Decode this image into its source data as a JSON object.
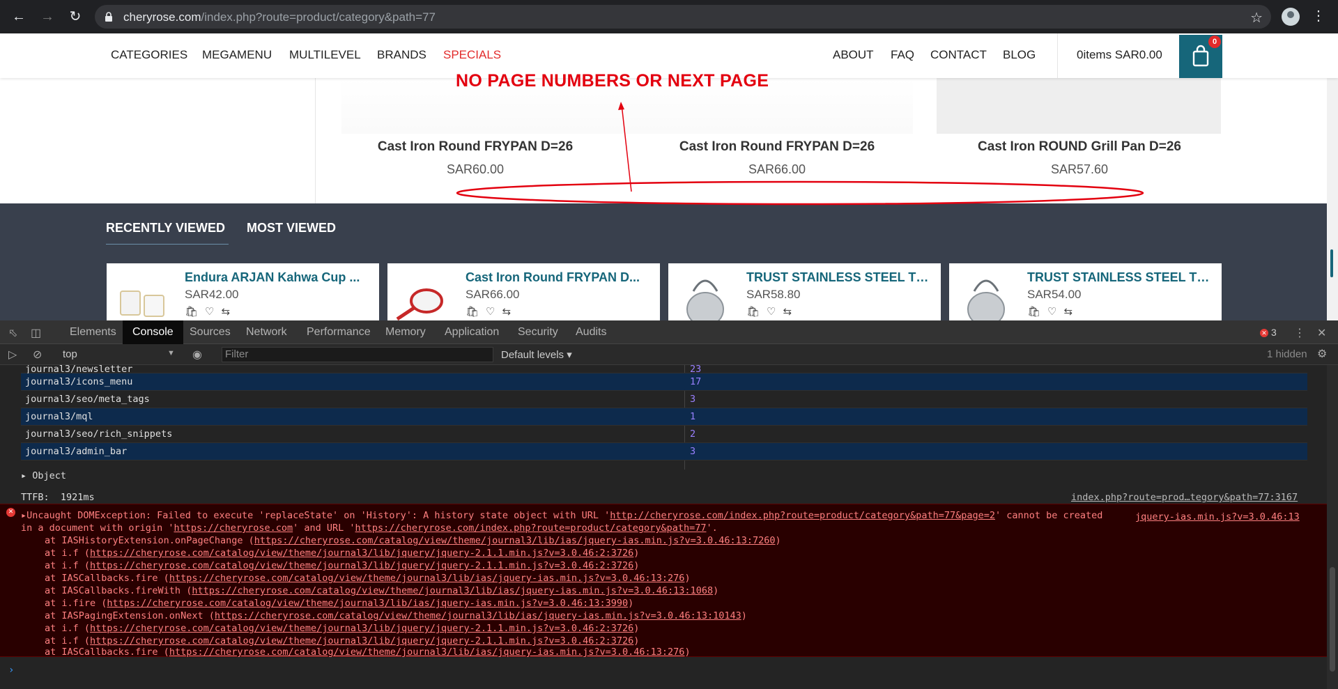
{
  "browser": {
    "url_host": "cheryrose.com",
    "url_path": "/index.php?route=product/category&path=77"
  },
  "header": {
    "menu_left": [
      "CATEGORIES",
      "MEGAMENU",
      "MULTILEVEL",
      "BRANDS",
      "SPECIALS"
    ],
    "menu_right": [
      "ABOUT",
      "FAQ",
      "CONTACT",
      "BLOG"
    ],
    "cart_text": "0items SAR0.00",
    "cart_badge": "0"
  },
  "annotation": {
    "text": "NO PAGE NUMBERS OR NEXT PAGE",
    "color": "#e3000f"
  },
  "products": [
    {
      "name": "Cast Iron Round FRYPAN D=26",
      "price": "SAR60.00"
    },
    {
      "name": "Cast Iron Round FRYPAN D=26",
      "price": "SAR66.00"
    },
    {
      "name": "Cast Iron ROUND Grill Pan D=26",
      "price": "SAR57.60"
    }
  ],
  "recent": {
    "tabs": [
      "RECENTLY VIEWED",
      "MOST VIEWED"
    ],
    "cards": [
      {
        "title": "Endura ARJAN Kahwa Cup ...",
        "price": "SAR42.00"
      },
      {
        "title": "Cast Iron Round FRYPAN D...",
        "price": "SAR66.00"
      },
      {
        "title": "TRUST STAINLESS STEEL TE...",
        "price": "SAR58.80"
      },
      {
        "title": "TRUST STAINLESS STEEL TE...",
        "price": "SAR54.00"
      }
    ]
  },
  "devtools": {
    "tabs": [
      "Elements",
      "Console",
      "Sources",
      "Network",
      "Performance",
      "Memory",
      "Application",
      "Security",
      "Audits"
    ],
    "active_tab": "Console",
    "error_count": "3",
    "context": "top",
    "filter_placeholder": "Filter",
    "levels": "Default levels ▾",
    "hidden": "1 hidden",
    "table_rows": [
      {
        "key": "journal3/newsletter",
        "value": "23"
      },
      {
        "key": "journal3/icons_menu",
        "value": "17"
      },
      {
        "key": "journal3/seo/meta_tags",
        "value": "3"
      },
      {
        "key": "journal3/mql",
        "value": "1"
      },
      {
        "key": "journal3/seo/rich_snippets",
        "value": "2"
      },
      {
        "key": "journal3/admin_bar",
        "value": "3"
      }
    ],
    "object_label": "Object",
    "ttfb_label": "TTFB:",
    "ttfb_value": "1921ms",
    "ttfb_source": "index.php?route=prod…tegory&path=77:3167",
    "error_source": "jquery-ias.min.js?v=3.0.46:13",
    "error_line1_prefix": "Uncaught DOMException: Failed to execute 'replaceState' on 'History': A history state object with URL '",
    "error_line1_url": "http://cheryrose.com/index.php?route=product/category&path=77&page=2",
    "error_line1_suffix": "' cannot be created",
    "error_line2_prefix": "in a document with origin '",
    "error_line2_origin": "https://cheryrose.com",
    "error_line2_mid": "' and URL '",
    "error_line2_url": "https://cheryrose.com/index.php?route=product/category&path=77",
    "error_line2_suffix": "'.",
    "stack": [
      {
        "fn": "at IASHistoryExtension.onPageChange (",
        "url": "https://cheryrose.com/catalog/view/theme/journal3/lib/ias/jquery-ias.min.js?v=3.0.46:13:7260",
        "end": ")"
      },
      {
        "fn": "at i.f (",
        "url": "https://cheryrose.com/catalog/view/theme/journal3/lib/jquery/jquery-2.1.1.min.js?v=3.0.46:2:3726",
        "end": ")"
      },
      {
        "fn": "at i.f (",
        "url": "https://cheryrose.com/catalog/view/theme/journal3/lib/jquery/jquery-2.1.1.min.js?v=3.0.46:2:3726",
        "end": ")"
      },
      {
        "fn": "at IASCallbacks.fire (",
        "url": "https://cheryrose.com/catalog/view/theme/journal3/lib/ias/jquery-ias.min.js?v=3.0.46:13:276",
        "end": ")"
      },
      {
        "fn": "at IASCallbacks.fireWith (",
        "url": "https://cheryrose.com/catalog/view/theme/journal3/lib/ias/jquery-ias.min.js?v=3.0.46:13:1068",
        "end": ")"
      },
      {
        "fn": "at i.fire (",
        "url": "https://cheryrose.com/catalog/view/theme/journal3/lib/ias/jquery-ias.min.js?v=3.0.46:13:3990",
        "end": ")"
      },
      {
        "fn": "at IASPagingExtension.onNext (",
        "url": "https://cheryrose.com/catalog/view/theme/journal3/lib/ias/jquery-ias.min.js?v=3.0.46:13:10143",
        "end": ")"
      },
      {
        "fn": "at i.f (",
        "url": "https://cheryrose.com/catalog/view/theme/journal3/lib/jquery/jquery-2.1.1.min.js?v=3.0.46:2:3726",
        "end": ")"
      },
      {
        "fn": "at i.f (",
        "url": "https://cheryrose.com/catalog/view/theme/journal3/lib/jquery/jquery-2.1.1.min.js?v=3.0.46:2:3726",
        "end": ")"
      },
      {
        "fn": "at IASCallbacks.fire (",
        "url": "https://cheryrose.com/catalog/view/theme/journal3/lib/ias/jquery-ias.min.js?v=3.0.46:13:276",
        "end": ")"
      }
    ]
  },
  "colors": {
    "brand_teal": "#16667a",
    "specials_red": "#e22a2a",
    "footer_bg": "#39404d",
    "console_error_bg": "#290000"
  }
}
